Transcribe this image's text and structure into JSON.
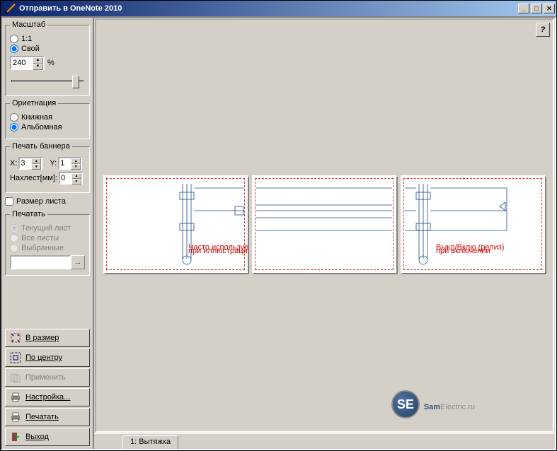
{
  "window": {
    "title": "Отправить в OneNote 2010"
  },
  "scale": {
    "legend": "Масштаб",
    "opt_1_1": "1:1",
    "opt_custom": "Свой",
    "value": "240",
    "percent": "%"
  },
  "orientation": {
    "legend": "Ориетнация",
    "opt_portrait": "Книжная",
    "opt_landscape": "Альбомная"
  },
  "banner": {
    "legend": "Печать баннера",
    "x_label": "X:",
    "x_value": "3",
    "y_label": "Y:",
    "y_value": "1",
    "overlap_label": "Нахлест[мм]:",
    "overlap_value": "0"
  },
  "papersize_label": "Размер листа",
  "print": {
    "legend": "Печатать",
    "opt_current": "Текущий лист",
    "opt_all": "Все листы",
    "opt_selected": "Выбранные",
    "file_btn": "..."
  },
  "buttons": {
    "fit": "В размер",
    "center": "По центру",
    "apply": "Применить",
    "setup": "Настройка...",
    "print": "Печатать",
    "exit": "Выход"
  },
  "tab": {
    "label": "1: Вытяжка"
  },
  "help": "?",
  "watermark": {
    "badge": "SE",
    "text_b": "Sam",
    "text_plain": "Electric.ru"
  }
}
